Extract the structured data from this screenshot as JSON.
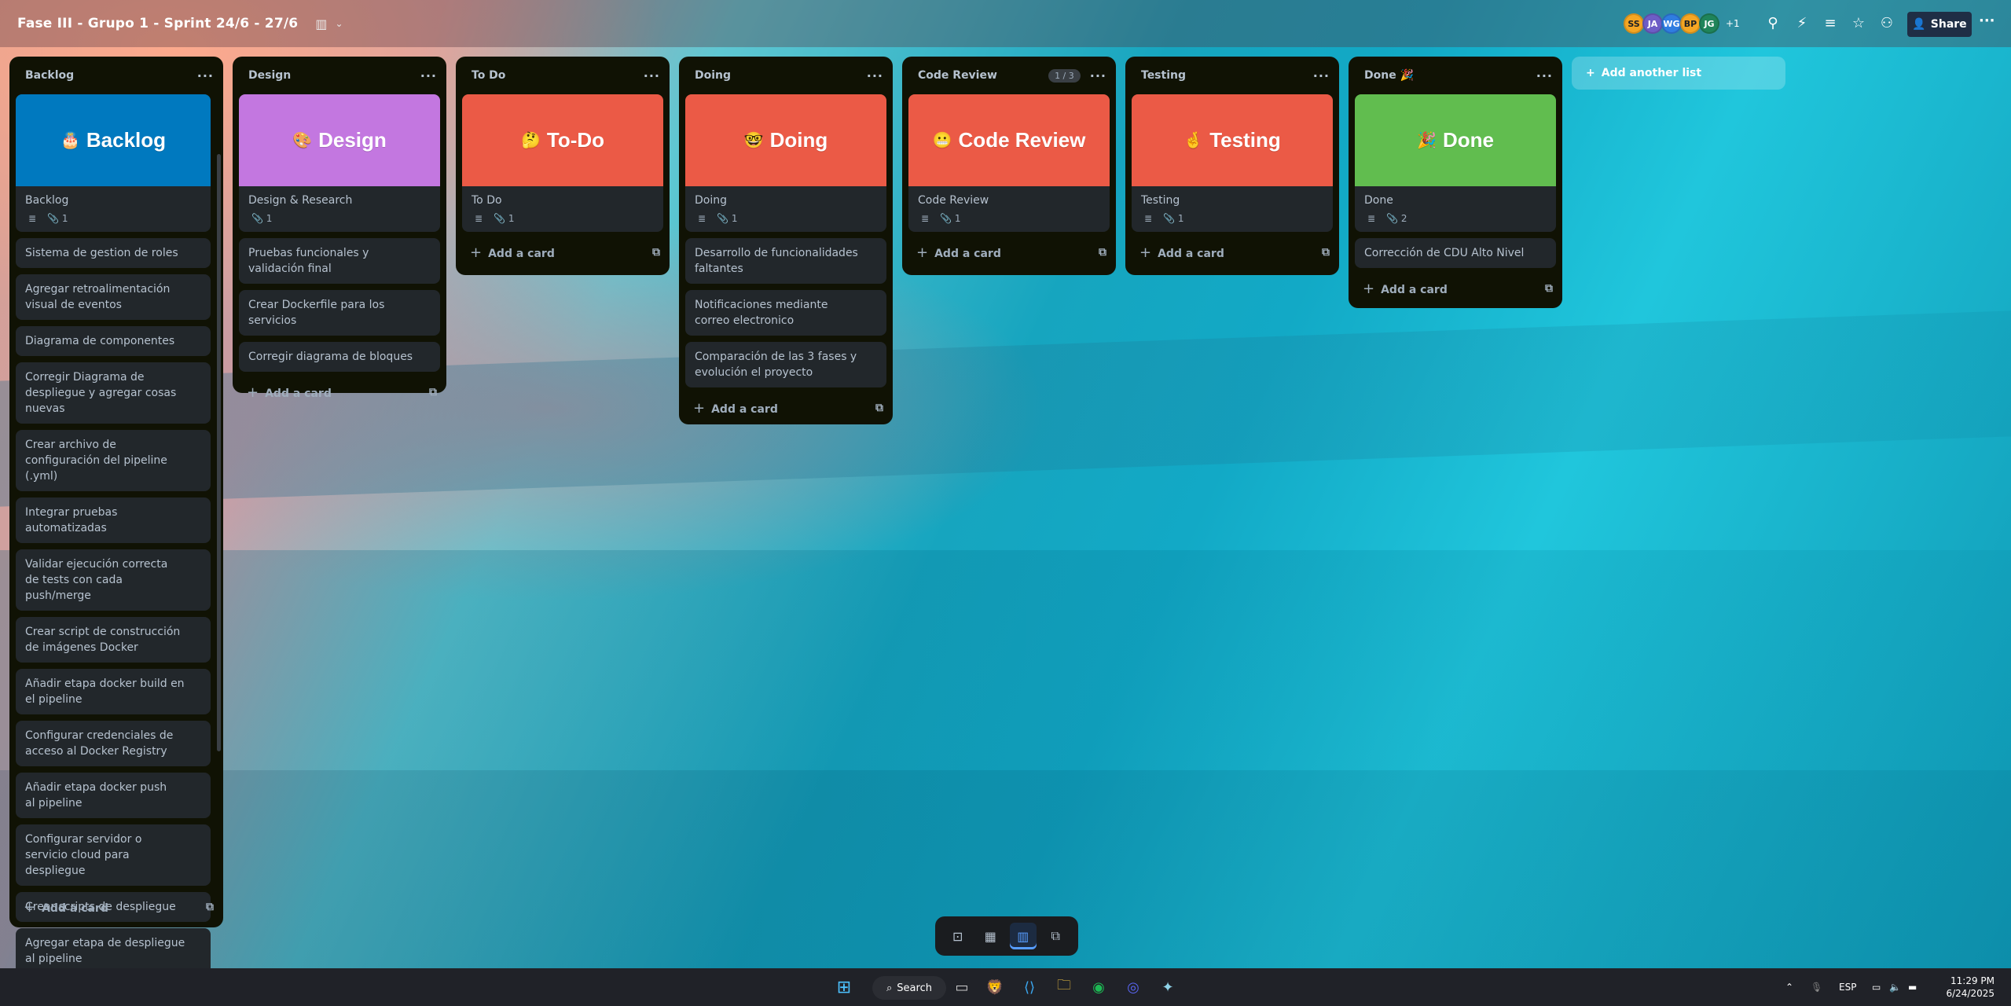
{
  "board": {
    "title": "Fase III - Grupo 1 - Sprint 24/6 - 27/6",
    "members": [
      {
        "initials": "SS",
        "color": "#f5a623"
      },
      {
        "initials": "JA",
        "color": "#6e5dc6"
      },
      {
        "initials": "WG",
        "color": "#2f7de1"
      },
      {
        "initials": "BP",
        "color": "#f5a623"
      },
      {
        "initials": "JG",
        "color": "#1f845a"
      }
    ],
    "more_members": "+1",
    "share_label": "Share",
    "add_list_label": "Add another list"
  },
  "lists": {
    "backlog": {
      "name": "Backlog",
      "cover_text": "Backlog",
      "cover_emoji": "🎂",
      "cover_color": "#0079bf",
      "cover_card_title": "Backlog",
      "attachments": "1",
      "cards": [
        "Sistema de gestion de roles",
        "Agregar retroalimentación visual de eventos",
        "Diagrama de componentes",
        "Corregir Diagrama de despliegue y agregar cosas nuevas",
        "Crear archivo de configuración del pipeline (.yml)",
        "Integrar pruebas automatizadas",
        "Validar ejecución correcta de tests con cada push/merge",
        "Crear script de construcción de imágenes Docker",
        "Añadir etapa docker build en el pipeline",
        "Configurar credenciales de acceso al Docker Registry",
        "Añadir etapa docker push al pipeline",
        "Configurar servidor o servicio cloud para despliegue",
        "Crear scripts de despliegue",
        "Agregar etapa de despliegue al pipeline"
      ],
      "add_card": "Add a card"
    },
    "design": {
      "name": "Design",
      "cover_text": "Design",
      "cover_emoji": "🎨",
      "cover_color": "#c377e0",
      "cover_card_title": "Design & Research",
      "attachments": "1",
      "cards": [
        "Pruebas funcionales y validación final",
        "Crear Dockerfile para los servicios",
        "Corregir diagrama de bloques"
      ],
      "add_card": "Add a card"
    },
    "todo": {
      "name": "To Do",
      "cover_text": "To-Do",
      "cover_emoji": "🤔",
      "cover_color": "#eb5a46",
      "cover_card_title": "To Do",
      "attachments": "1",
      "add_card": "Add a card"
    },
    "doing": {
      "name": "Doing",
      "cover_text": "Doing",
      "cover_emoji": "🤓",
      "cover_color": "#eb5a46",
      "cover_card_title": "Doing",
      "attachments": "1",
      "cards": [
        "Desarrollo de funcionalidades faltantes",
        "Notificaciones mediante correo electronico",
        "Comparación de las 3 fases y evolución el proyecto"
      ],
      "add_card": "Add a card"
    },
    "code_review": {
      "name": "Code Review",
      "badge": "1 / 3",
      "cover_text": "Code Review",
      "cover_emoji": "😬",
      "cover_color": "#eb5a46",
      "cover_card_title": "Code Review",
      "attachments": "1",
      "add_card": "Add a card"
    },
    "testing": {
      "name": "Testing",
      "cover_text": "Testing",
      "cover_emoji": "🤞",
      "cover_color": "#eb5a46",
      "cover_card_title": "Testing",
      "attachments": "1",
      "add_card": "Add a card"
    },
    "done": {
      "name": "Done 🎉",
      "cover_text": "Done",
      "cover_emoji": "🎉",
      "cover_color": "#61bd4f",
      "cover_card_title": "Done",
      "attachments": "2",
      "cards": [
        "Corrección de CDU Alto Nivel"
      ],
      "add_card": "Add a card"
    }
  },
  "taskbar": {
    "search_label": "Search",
    "language": "ESP",
    "time": "11:29 PM",
    "date": "6/24/2025"
  }
}
